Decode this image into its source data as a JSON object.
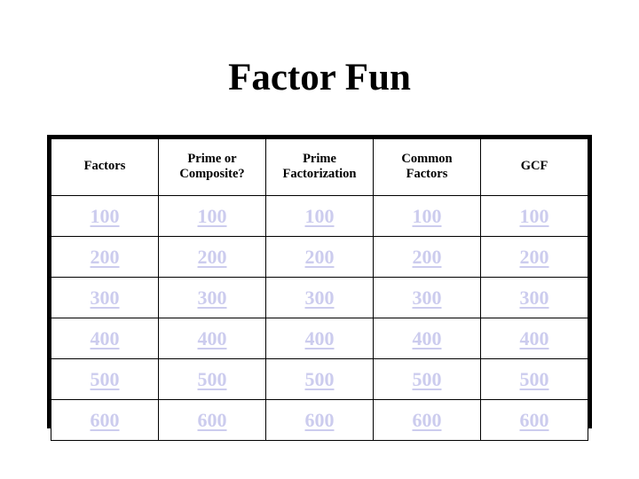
{
  "slide": {
    "title": "Factor Fun",
    "background_color": "#ffffff",
    "title_color": "#000000"
  },
  "board": {
    "link_color": "#ccccee",
    "border_color": "#000000",
    "columns": [
      {
        "id": "factors",
        "label_lines": [
          "Factors"
        ]
      },
      {
        "id": "prime-or-composite",
        "label_lines": [
          "Prime or",
          "Composite?"
        ]
      },
      {
        "id": "prime-factorization",
        "label_lines": [
          "Prime",
          "Factorization"
        ]
      },
      {
        "id": "common-factors",
        "label_lines": [
          "Common",
          "Factors"
        ]
      },
      {
        "id": "gcf",
        "label_lines": [
          "GCF"
        ]
      }
    ],
    "rows": [
      {
        "value": "100",
        "cells": [
          "100",
          "100",
          "100",
          "100",
          "100"
        ]
      },
      {
        "value": "200",
        "cells": [
          "200",
          "200",
          "200",
          "200",
          "200"
        ]
      },
      {
        "value": "300",
        "cells": [
          "300",
          "300",
          "300",
          "300",
          "300"
        ]
      },
      {
        "value": "400",
        "cells": [
          "400",
          "400",
          "400",
          "400",
          "400"
        ]
      },
      {
        "value": "500",
        "cells": [
          "500",
          "500",
          "500",
          "500",
          "500"
        ]
      },
      {
        "value": "600",
        "cells": [
          "600",
          "600",
          "600",
          "600",
          "600"
        ]
      }
    ]
  }
}
